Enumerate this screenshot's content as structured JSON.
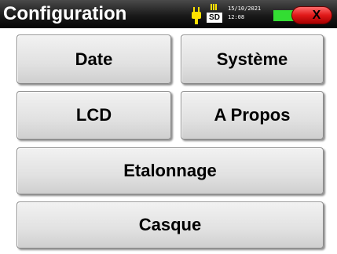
{
  "header": {
    "title": "Configuration",
    "sd_label": "SD",
    "date": "15/10/2021",
    "time": "12:08",
    "close_label": "X"
  },
  "icons": {
    "power": "plug-icon",
    "storage": "sd-card-icon",
    "battery": "battery-icon"
  },
  "menu": {
    "date": "Date",
    "systeme": "Système",
    "lcd": "LCD",
    "apropos": "A Propos",
    "etalonnage": "Etalonnage",
    "casque": "Casque"
  },
  "colors": {
    "plug": "#ffe000",
    "battery": "#33dd33",
    "close": "#e01818"
  }
}
